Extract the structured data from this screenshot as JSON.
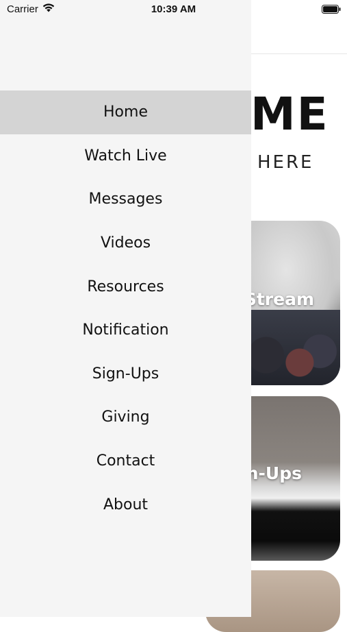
{
  "status_bar": {
    "carrier": "Carrier",
    "time": "10:39 AM",
    "icons": [
      "wifi-icon",
      "battery-icon"
    ]
  },
  "background": {
    "hero_title": "ME",
    "hero_subtitle": "HERE",
    "cards": [
      {
        "label": "Stream"
      },
      {
        "label": "n-Ups"
      },
      {
        "label": ""
      }
    ]
  },
  "drawer": {
    "active_index": 0,
    "active_color": "#d4d4d4",
    "background_color": "#f5f5f5",
    "items": [
      {
        "label": "Home"
      },
      {
        "label": "Watch Live"
      },
      {
        "label": "Messages"
      },
      {
        "label": "Videos"
      },
      {
        "label": "Resources"
      },
      {
        "label": "Notification"
      },
      {
        "label": "Sign-Ups"
      },
      {
        "label": "Giving"
      },
      {
        "label": "Contact"
      },
      {
        "label": "About"
      }
    ]
  }
}
